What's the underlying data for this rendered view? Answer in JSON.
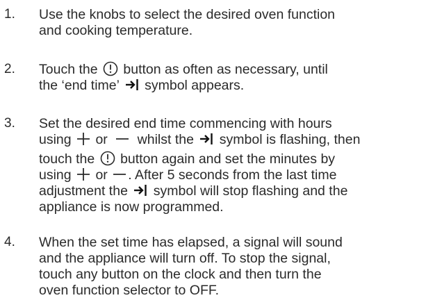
{
  "steps": [
    {
      "number": "1.",
      "lines": [
        {
          "text": "Use the knobs to select the desired oven function"
        },
        {
          "text": "and cooking temperature."
        }
      ]
    },
    {
      "number": "2.",
      "lines": [
        {
          "pre": "Touch the ",
          "icon": "clock-icon",
          "post": " button as often as necessary, until"
        },
        {
          "pre": "the ‘end time’ ",
          "icon": "end-time-icon",
          "post": " symbol appears."
        }
      ]
    },
    {
      "number": "3.",
      "lines": [
        {
          "text": "Set the desired end time commencing with hours"
        },
        {
          "a": "using ",
          "b": " or ",
          "c": " whilst the ",
          "d": " symbol is flashing, then"
        },
        {
          "pre": "touch the ",
          "icon": "clock-icon",
          "post": " button again and set the minutes by"
        },
        {
          "a": "using ",
          "b": " or ",
          "c": ". After 5 seconds from the last time"
        },
        {
          "pre": "adjustment the ",
          "icon": "end-time-icon",
          "post": " symbol will stop flashing and the"
        },
        {
          "text": "appliance is now programmed."
        }
      ]
    },
    {
      "number": "4.",
      "lines": [
        {
          "text": "When the set time has elapsed, a signal will sound"
        },
        {
          "text": "and the appliance will turn off. To stop the signal,"
        },
        {
          "text": "touch any button on the clock and then turn the"
        },
        {
          "text": "oven function selector to OFF."
        }
      ]
    }
  ],
  "icons": {
    "clock": "clock-icon",
    "end_time": "end-time-icon",
    "plus": "plus-icon",
    "minus": "minus-icon"
  }
}
